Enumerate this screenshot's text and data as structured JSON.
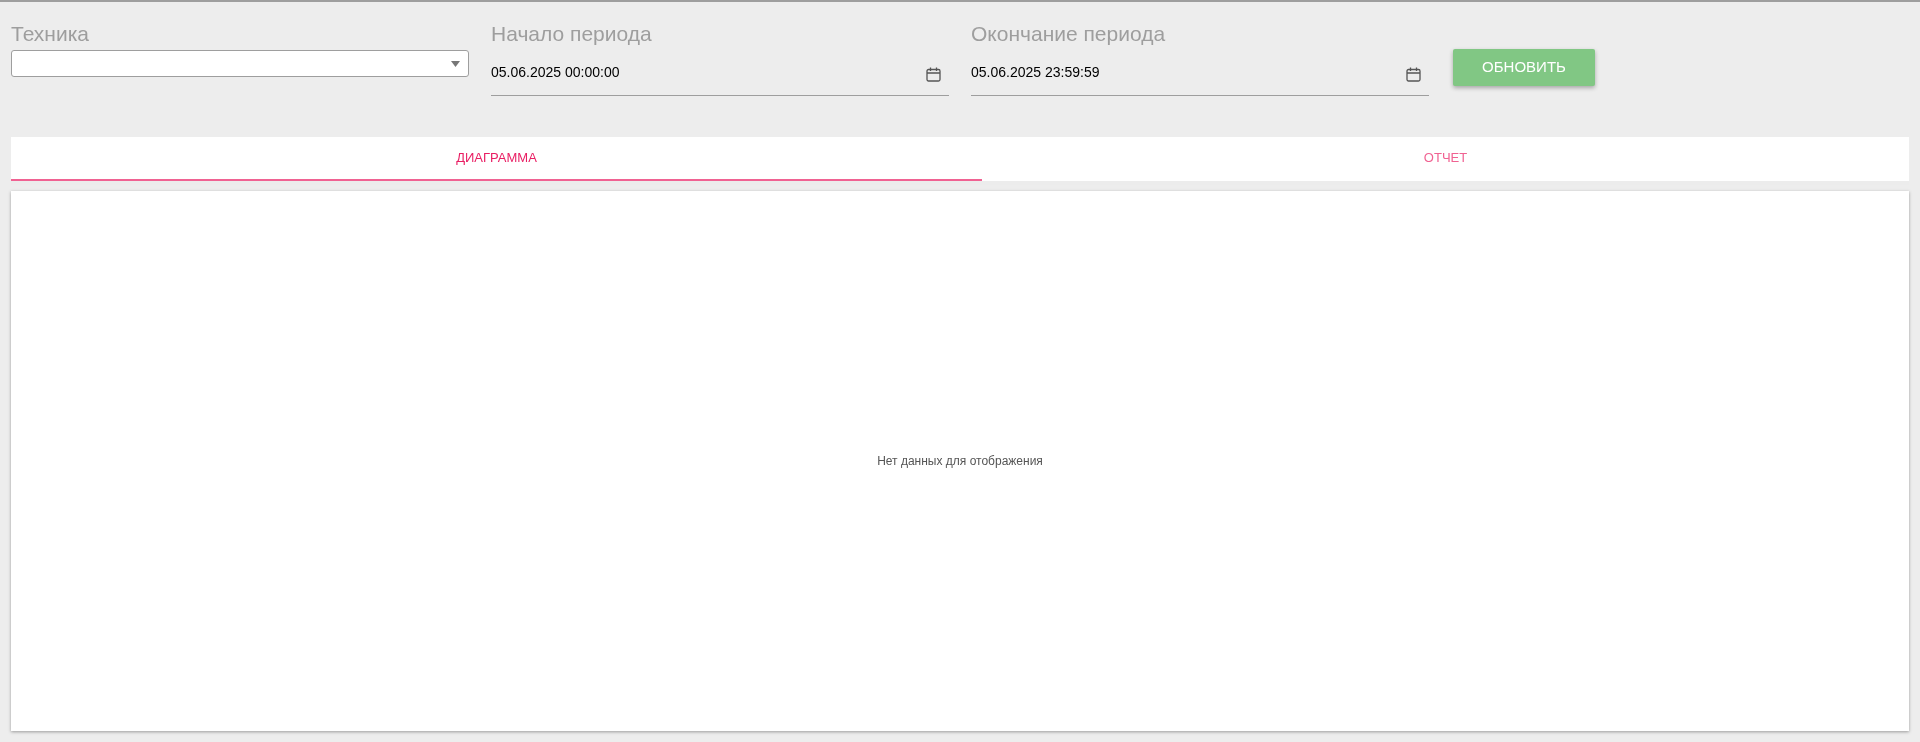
{
  "filters": {
    "equipment": {
      "label": "Техника"
    },
    "period_start": {
      "label": "Начало периода",
      "value": "05.06.2025 00:00:00"
    },
    "period_end": {
      "label": "Окончание периода",
      "value": "05.06.2025 23:59:59"
    },
    "refresh_button": "ОБНОВИТЬ"
  },
  "tabs": [
    {
      "label": "ДИАГРАММА",
      "selected": true
    },
    {
      "label": "ОТЧЕТ",
      "selected": false
    }
  ],
  "panel": {
    "empty_message": "Нет данных для отображения"
  }
}
